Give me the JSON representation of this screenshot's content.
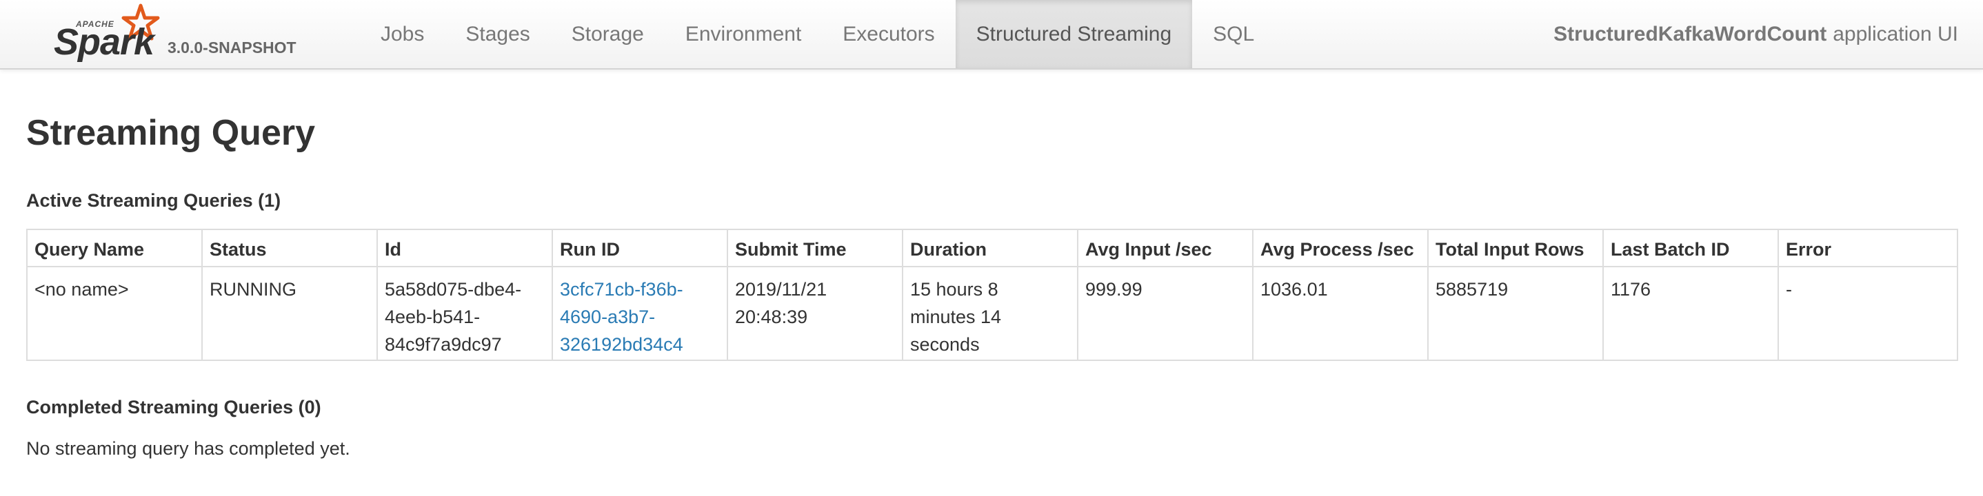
{
  "brand": {
    "apache_label": "APACHE",
    "name": "Spark",
    "version": "3.0.0-SNAPSHOT",
    "star_color": "#e25a1c"
  },
  "nav": {
    "items": [
      {
        "label": "Jobs"
      },
      {
        "label": "Stages"
      },
      {
        "label": "Storage"
      },
      {
        "label": "Environment"
      },
      {
        "label": "Executors"
      },
      {
        "label": "Structured Streaming",
        "active": true
      },
      {
        "label": "SQL"
      }
    ],
    "app_name": "StructuredKafkaWordCount",
    "app_suffix": "application UI"
  },
  "page": {
    "title": "Streaming Query"
  },
  "active_section": {
    "title": "Active Streaming Queries (1)",
    "columns": [
      "Query Name",
      "Status",
      "Id",
      "Run ID",
      "Submit Time",
      "Duration",
      "Avg Input /sec",
      "Avg Process /sec",
      "Total Input Rows",
      "Last Batch ID",
      "Error"
    ],
    "rows": [
      {
        "query_name": "<no name>",
        "status": "RUNNING",
        "id": "5a58d075-dbe4-4eeb-b541-84c9f7a9dc97",
        "run_id": "3cfc71cb-f36b-4690-a3b7-326192bd34c4",
        "submit_time": "2019/11/21 20:48:39",
        "duration": "15 hours 8 minutes 14 seconds",
        "avg_input": "999.99",
        "avg_process": "1036.01",
        "total_input_rows": "5885719",
        "last_batch_id": "1176",
        "error": "-"
      }
    ]
  },
  "completed_section": {
    "title": "Completed Streaming Queries (0)",
    "empty_message": "No streaming query has completed yet."
  },
  "colors": {
    "link": "#2a7bb4",
    "nav_text": "#777777",
    "border": "#dddddd"
  }
}
